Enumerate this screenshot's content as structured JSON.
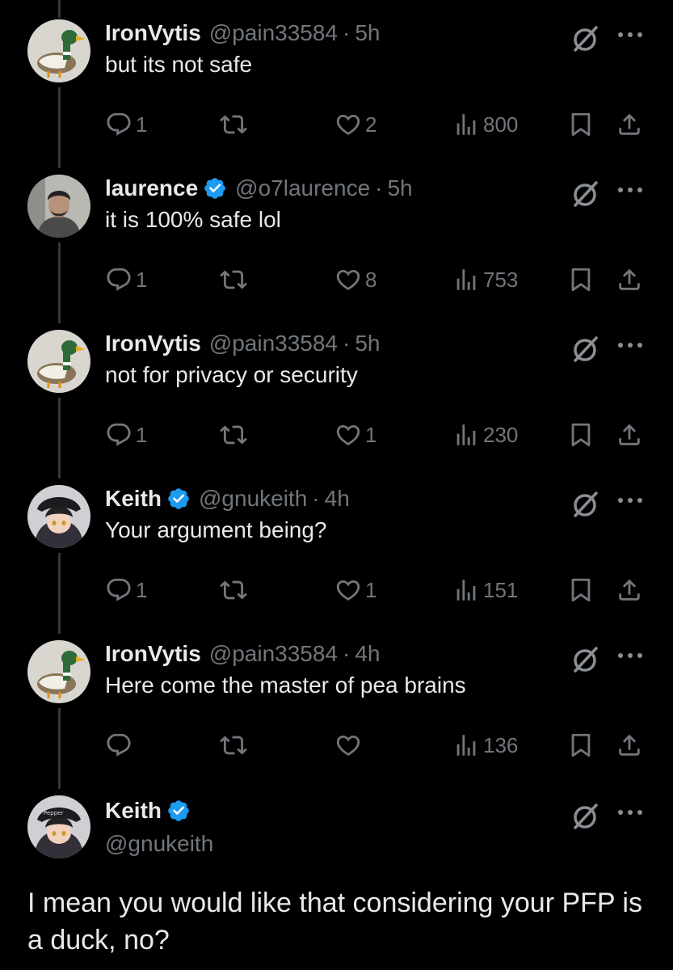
{
  "tweets": [
    {
      "name": "IronVytis",
      "handle": "@pain33584",
      "dot": "·",
      "time": "5h",
      "text": "but its not safe",
      "verified": false,
      "avatar": "duck-avatar",
      "replies": "1",
      "likes": "2",
      "views": "800"
    },
    {
      "name": "laurence",
      "handle": "@o7laurence",
      "dot": "·",
      "time": "5h",
      "text": "it is 100% safe lol",
      "verified": true,
      "avatar": "man-avatar",
      "replies": "1",
      "likes": "8",
      "views": "753"
    },
    {
      "name": "IronVytis",
      "handle": "@pain33584",
      "dot": "·",
      "time": "5h",
      "text": "not for privacy or security",
      "verified": false,
      "avatar": "duck-avatar",
      "replies": "1",
      "likes": "1",
      "views": "230"
    },
    {
      "name": "Keith",
      "handle": "@gnukeith",
      "dot": "·",
      "time": "4h",
      "text": "Your argument being?",
      "verified": true,
      "avatar": "anime-avatar",
      "replies": "1",
      "likes": "1",
      "views": "151"
    },
    {
      "name": "IronVytis",
      "handle": "@pain33584",
      "dot": "·",
      "time": "4h",
      "text": "Here come the master of pea brains",
      "verified": false,
      "avatar": "duck-avatar",
      "replies": "",
      "likes": "",
      "views": "136"
    }
  ],
  "main_tweet": {
    "name": "Keith",
    "handle": "@gnukeith",
    "verified": true,
    "avatar": "anime-avatar",
    "avatar_cap_text": "Pepper",
    "text": "I mean you would like that considering your PFP is a duck, no?"
  },
  "colors": {
    "background": "#000000",
    "text": "#e7e9ea",
    "muted": "#71767b",
    "verified": "#1d9bf0",
    "thread_line": "#333639"
  },
  "icons": [
    "reply-icon",
    "retweet-icon",
    "like-icon",
    "views-icon",
    "bookmark-icon",
    "share-icon",
    "grok-icon",
    "more-icon",
    "verified-badge-icon"
  ]
}
